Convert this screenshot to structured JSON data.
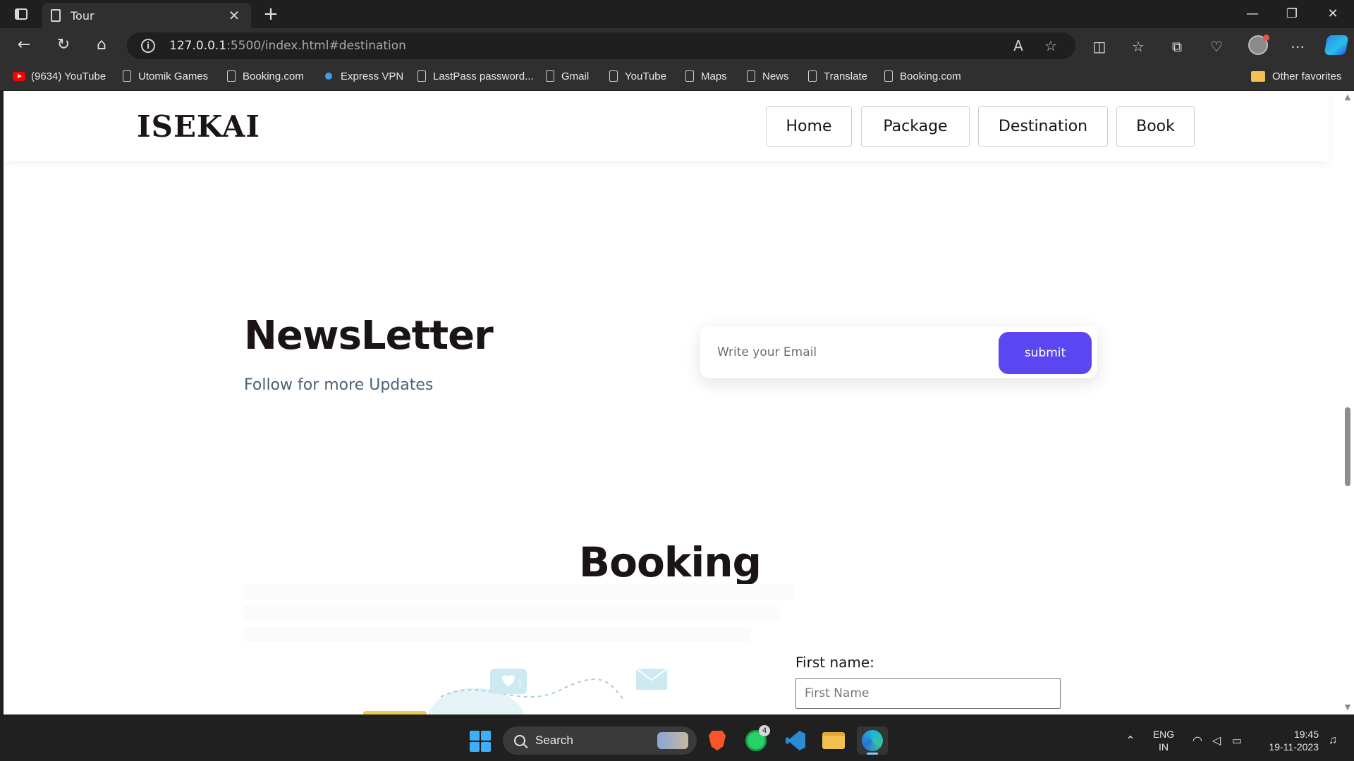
{
  "browser": {
    "tab_title": "Tour",
    "tab_close": "✕",
    "new_tab": "+",
    "url_host": "127.0.0.1",
    "url_rest": ":5500/index.html#destination",
    "window_controls": {
      "minimize": "—",
      "restore": "❐",
      "close": "✕"
    },
    "bookmarks": [
      {
        "label": "(9634) YouTube",
        "icon": "youtube-icon"
      },
      {
        "label": "Utomik Games",
        "icon": "page-icon"
      },
      {
        "label": "Booking.com",
        "icon": "page-icon"
      },
      {
        "label": "Express VPN",
        "icon": "vpn-icon"
      },
      {
        "label": "LastPass password...",
        "icon": "page-icon"
      },
      {
        "label": "Gmail",
        "icon": "page-icon"
      },
      {
        "label": "YouTube",
        "icon": "page-icon"
      },
      {
        "label": "Maps",
        "icon": "page-icon"
      },
      {
        "label": "News",
        "icon": "page-icon"
      },
      {
        "label": "Translate",
        "icon": "page-icon"
      },
      {
        "label": "Booking.com",
        "icon": "page-icon"
      }
    ],
    "other_favorites": "Other favorites"
  },
  "site": {
    "logo": "ISEKAI",
    "nav": [
      "Home",
      "Package",
      "Destination",
      "Book"
    ],
    "newsletter": {
      "title": "NewsLetter",
      "subtitle": "Follow for more Updates",
      "email_placeholder": "Write your Email",
      "submit_label": "submit"
    },
    "booking": {
      "title": "Booking",
      "first_name_label": "First name:",
      "first_name_placeholder": "First Name",
      "illustration_badge": "1"
    }
  },
  "taskbar": {
    "search_label": "Search",
    "whatsapp_badge": "4",
    "lang_line1": "ENG",
    "lang_line2": "IN",
    "time": "19:45",
    "date": "19-11-2023"
  },
  "colors": {
    "accent": "#5b46f2",
    "text_dark": "#1b1414",
    "subtitle": "#4b6178"
  }
}
